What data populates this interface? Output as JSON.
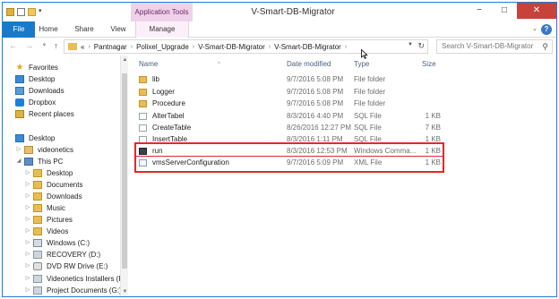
{
  "window": {
    "title": "V-Smart-DB-Migrator",
    "contextual_group": "Application Tools",
    "controls": {
      "minimize": "−",
      "maximize": "□",
      "close": "✕"
    }
  },
  "ribbon": {
    "tabs": [
      {
        "label": "File"
      },
      {
        "label": "Home"
      },
      {
        "label": "Share"
      },
      {
        "label": "View"
      },
      {
        "label": "Manage"
      }
    ],
    "help_label": "?"
  },
  "address": {
    "breadcrumb_prefix": "«",
    "path": [
      "Pantnagar",
      "Polixel_Upgrade",
      "V-Smart-DB-Migrator",
      "V-Smart-DB-Migrator"
    ],
    "search_placeholder": "Search V-Smart-DB-Migrator"
  },
  "navigation": {
    "favorites_label": "Favorites",
    "favorites": [
      "Desktop",
      "Downloads",
      "Dropbox",
      "Recent places"
    ],
    "desktop_label": "Desktop",
    "user_label": "videonetics",
    "thispc_label": "This PC",
    "thispc_items": [
      {
        "label": "Desktop",
        "icon": "folder"
      },
      {
        "label": "Documents",
        "icon": "folder"
      },
      {
        "label": "Downloads",
        "icon": "folder"
      },
      {
        "label": "Music",
        "icon": "folder"
      },
      {
        "label": "Pictures",
        "icon": "folder"
      },
      {
        "label": "Videos",
        "icon": "folder"
      },
      {
        "label": "Windows (C:)",
        "icon": "windrive"
      },
      {
        "label": "RECOVERY (D:)",
        "icon": "drive"
      },
      {
        "label": "DVD RW Drive (E:)",
        "icon": "dvd"
      },
      {
        "label": "Videonetics Installers (F:)",
        "icon": "drive"
      },
      {
        "label": "Project Documents (G:)",
        "icon": "drive"
      }
    ]
  },
  "files": {
    "columns": {
      "name": "Name",
      "date": "Date modified",
      "type": "Type",
      "size": "Size"
    },
    "rows": [
      {
        "name": "lib",
        "date": "9/7/2016 5:08 PM",
        "type": "File folder",
        "size": "",
        "icon": "folder"
      },
      {
        "name": "Logger",
        "date": "9/7/2016 5:08 PM",
        "type": "File folder",
        "size": "",
        "icon": "folder"
      },
      {
        "name": "Procedure",
        "date": "9/7/2016 5:08 PM",
        "type": "File folder",
        "size": "",
        "icon": "folder"
      },
      {
        "name": "AlterTabel",
        "date": "8/3/2016 4:40 PM",
        "type": "SQL File",
        "size": "1 KB",
        "icon": "file"
      },
      {
        "name": "CreateTable",
        "date": "8/26/2016 12:27 PM",
        "type": "SQL File",
        "size": "7 KB",
        "icon": "file"
      },
      {
        "name": "InsertTable",
        "date": "8/3/2016 1:11 PM",
        "type": "SQL File",
        "size": "1 KB",
        "icon": "file"
      },
      {
        "name": "run",
        "date": "8/3/2016 12:53 PM",
        "type": "Windows Comma...",
        "size": "1 KB",
        "icon": "cmd"
      },
      {
        "name": "vmsServerConfiguration",
        "date": "9/7/2016 5:09 PM",
        "type": "XML File",
        "size": "1 KB",
        "icon": "xml"
      }
    ]
  }
}
